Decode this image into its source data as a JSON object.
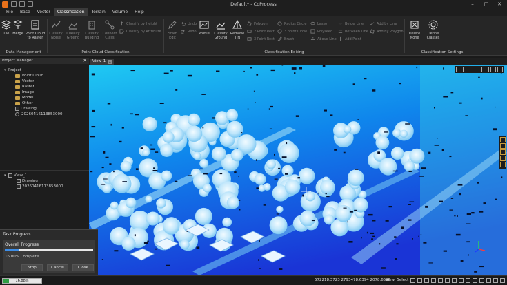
{
  "window": {
    "title": "Default* - CoProcess",
    "minimize": "–",
    "maximize": "□",
    "close": "✕"
  },
  "menu": [
    "File",
    "Base",
    "Vector",
    "Classification",
    "Terrain",
    "Volume",
    "Help"
  ],
  "ribbon": {
    "groups": {
      "data_management": "Data Management",
      "point_cloud_classification": "Point Cloud Classification",
      "classification_editing": "Classification Editing",
      "classification_settings": "Classification Settings"
    },
    "buttons": {
      "tile": "Tile",
      "merge": "Merge",
      "pc_to_raster": "Point Cloud\nto Raster",
      "classify_noise": "Classify\nNoise",
      "classify_ground": "Classify\nGround",
      "classify_building": "Classify\nBuilding",
      "connect_class": "Connect\nClass",
      "start_edit": "Start\nEdit",
      "profile": "Profile",
      "classify_ground_edit": "Classify\nGround",
      "remove_tin": "Remove\nTIN",
      "delete_none": "Delete\nNone",
      "define_classes": "Define\nClasses"
    },
    "small": {
      "by_height": "Classify by Height",
      "by_attribute": "Classify by Attribute",
      "undo": "Undo",
      "redo": "Redo",
      "polygon": "Polygon",
      "two_point_rect": "2 Point Rect",
      "three_point_rect": "3 Point Rect",
      "radius_circle": "Radius Circle",
      "three_point_circle": "3 point Circle",
      "brush": "Brush",
      "lasso": "Lasso",
      "polyseed": "Polyseed",
      "above_line": "Above Line",
      "below_line": "Below Line",
      "between_line": "Between Line",
      "add_point": "Add Point",
      "add_by_line": "Add by Line",
      "add_by_polygon": "Add by Polygon"
    }
  },
  "project_manager": {
    "title": "Project Manager",
    "close": "✕",
    "tree": {
      "project": "Project",
      "point_cloud": "Point Cloud",
      "vector": "Vector",
      "raster": "Raster",
      "image": "Image",
      "model": "Model",
      "other": "Other",
      "drawing": "Drawing",
      "item": "20260416113853000"
    },
    "view_tree": {
      "view": "View_1",
      "drawing": "Drawing",
      "item": "20260416113853000"
    }
  },
  "task": {
    "title": "Task Progress",
    "overall_label": "Overall Progress",
    "progress": 0.16,
    "percent_text": "16.00% Complete",
    "stop": "Stop",
    "cancel": "Cancel",
    "close": "Close"
  },
  "view_tab": {
    "label": "View_1",
    "close": "x"
  },
  "status": {
    "progress": 0.1688,
    "progress_text": "16.88%",
    "coords": "572218.3723 2793478.6394 2078.6596",
    "view_mode": "View: Select"
  },
  "colors": {
    "accent": "#3d8ee8",
    "logo": "#e8711a",
    "status_progress": "#2f9e44"
  }
}
